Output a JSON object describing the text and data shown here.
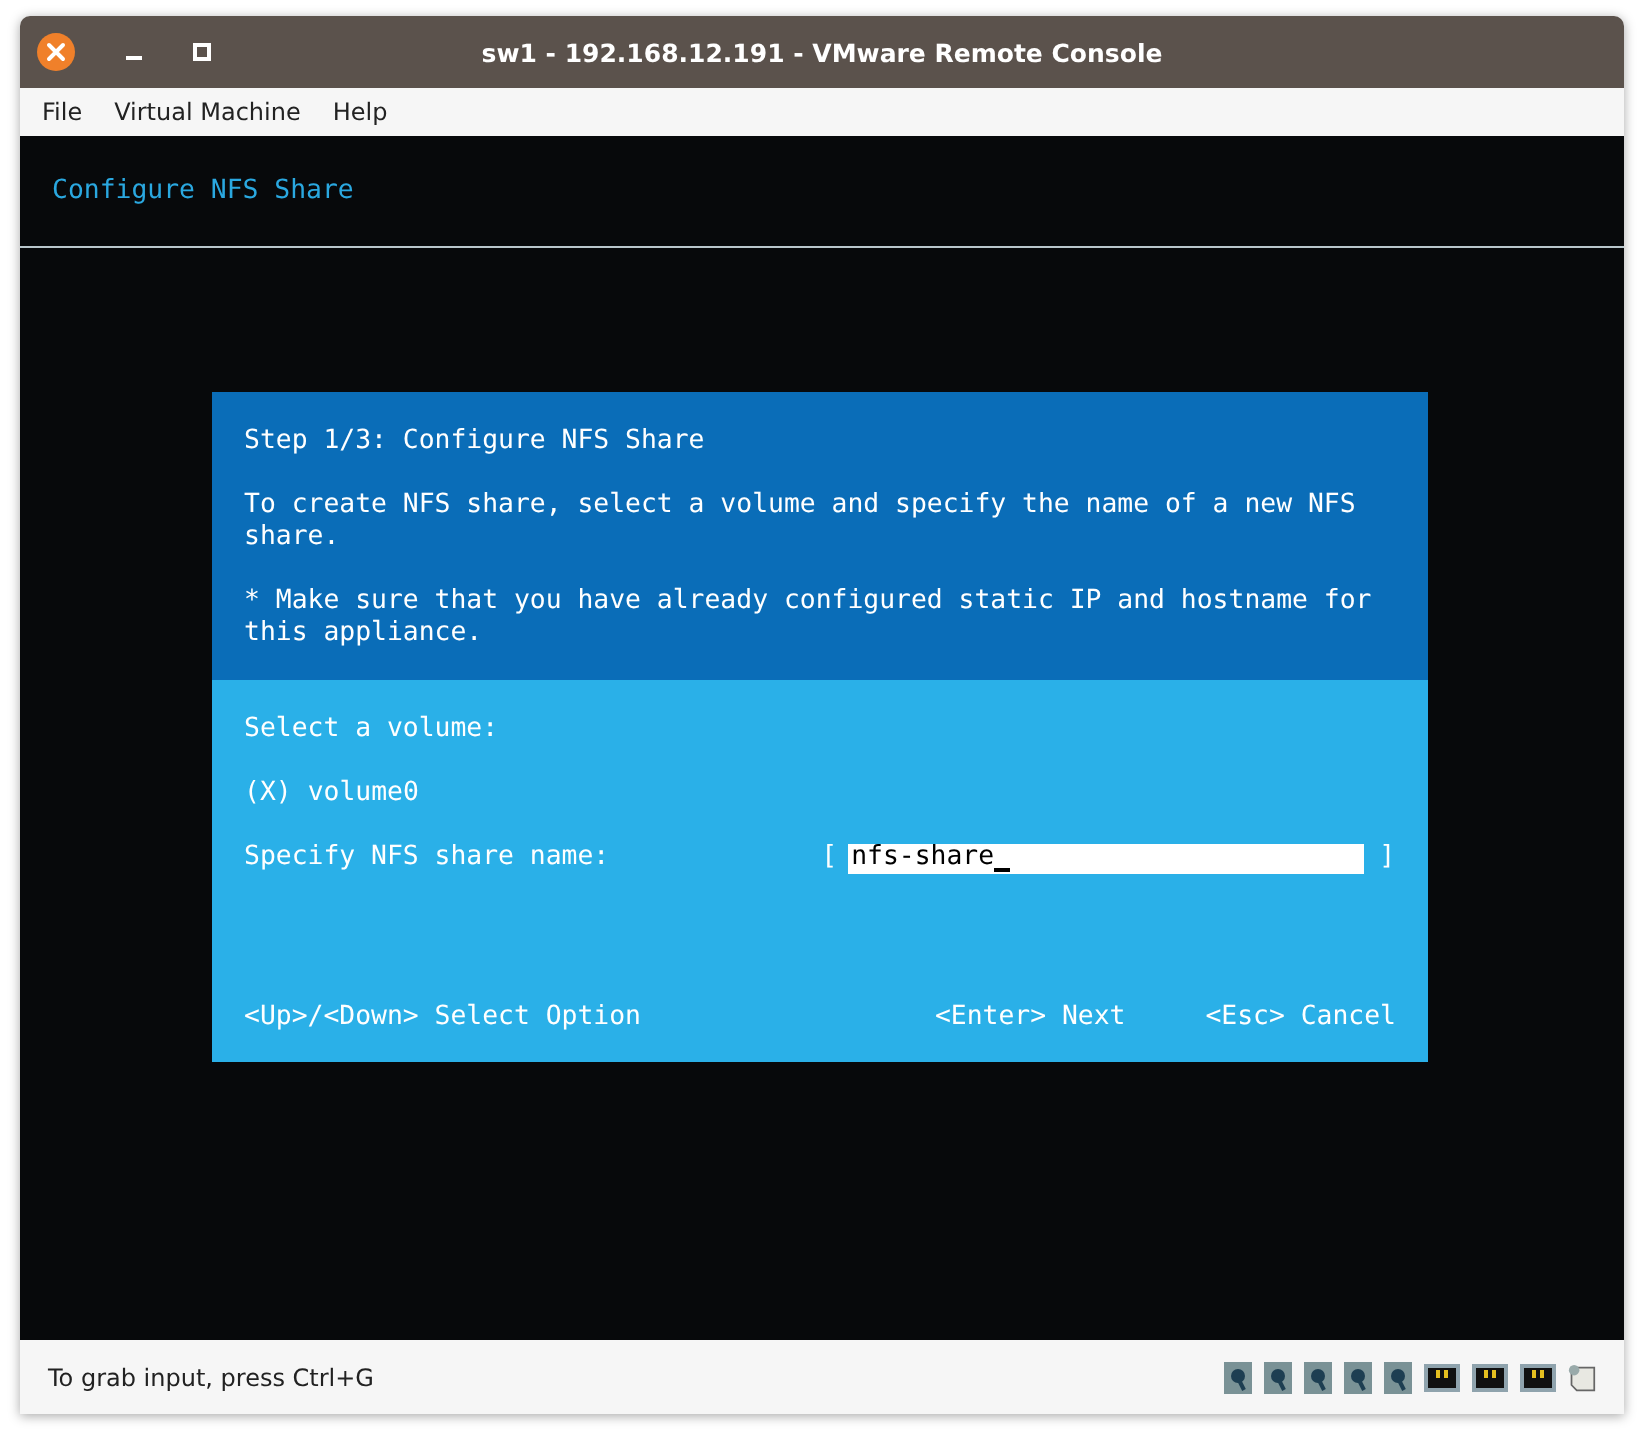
{
  "window": {
    "title": "sw1 - 192.168.12.191 - VMware Remote Console"
  },
  "menu": [
    "File",
    "Virtual Machine",
    "Help"
  ],
  "console": {
    "header": "Configure NFS Share",
    "dialog": {
      "title": "Step 1/3: Configure NFS Share",
      "description": "To create NFS share, select a volume and specify the name of a new NFS share.",
      "note": "* Make sure that you have already configured static IP and hostname for this appliance.",
      "volume_label": "Select a volume:",
      "volumes": [
        {
          "marker": "(X)",
          "label": "volume0"
        }
      ],
      "share_name": {
        "label": "Specify NFS share name:",
        "open": "[",
        "value": "nfs-share",
        "close": "]",
        "focused": true
      },
      "hints": [
        "<Up>/<Down> Select Option",
        "<Enter> Next",
        "<Esc> Cancel"
      ]
    }
  },
  "status_bar": {
    "text": "To grab input, press Ctrl+G",
    "devices": [
      {
        "kind": "drive"
      },
      {
        "kind": "drive"
      },
      {
        "kind": "drive"
      },
      {
        "kind": "drive"
      },
      {
        "kind": "drive"
      },
      {
        "kind": "network"
      },
      {
        "kind": "network"
      },
      {
        "kind": "network"
      },
      {
        "kind": "note"
      }
    ]
  }
}
